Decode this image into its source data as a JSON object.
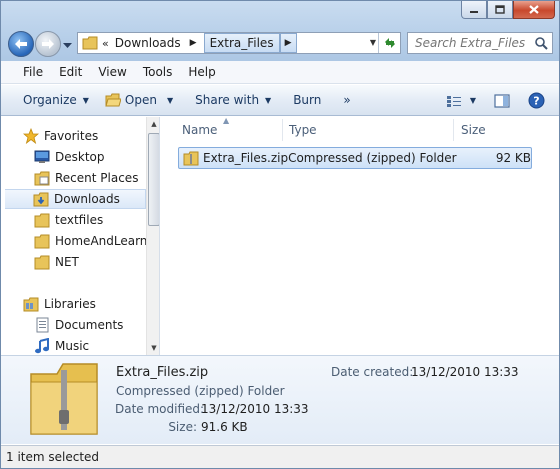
{
  "window": {
    "controls": {
      "minimize": "minimize",
      "maximize": "maximize",
      "close": "close"
    }
  },
  "address": {
    "overflow": "«",
    "crumbs": [
      {
        "label": "Downloads"
      },
      {
        "label": "Extra_Files"
      }
    ]
  },
  "search": {
    "placeholder": "Search Extra_Files"
  },
  "menu": [
    "File",
    "Edit",
    "View",
    "Tools",
    "Help"
  ],
  "toolbar": {
    "organize": "Organize",
    "open": "Open",
    "share_with": "Share with",
    "burn": "Burn",
    "more": "»"
  },
  "nav": {
    "favorites_header": "Favorites",
    "favorites": [
      {
        "label": "Desktop",
        "icon": "desktop-icon"
      },
      {
        "label": "Recent Places",
        "icon": "recent-places-icon"
      },
      {
        "label": "Downloads",
        "icon": "downloads-folder-icon",
        "selected": true
      },
      {
        "label": "textfiles",
        "icon": "folder-icon"
      },
      {
        "label": "HomeAndLearn",
        "icon": "folder-icon"
      },
      {
        "label": "NET",
        "icon": "folder-icon"
      }
    ],
    "libraries_header": "Libraries",
    "libraries": [
      {
        "label": "Documents",
        "icon": "documents-icon"
      },
      {
        "label": "Music",
        "icon": "music-icon"
      }
    ]
  },
  "columns": {
    "name": "Name",
    "type": "Type",
    "size": "Size"
  },
  "files": [
    {
      "name": "Extra_Files.zip",
      "type": "Compressed (zipped) Folder",
      "size": "92 KB"
    }
  ],
  "details": {
    "filename": "Extra_Files.zip",
    "type": "Compressed (zipped) Folder",
    "date_modified_label": "Date modified:",
    "date_modified": "13/12/2010 13:33",
    "size_label": "Size:",
    "size": "91.6 KB",
    "date_created_label": "Date created:",
    "date_created": "13/12/2010 13:33"
  },
  "status": {
    "text": "1 item selected"
  },
  "colors": {
    "accent": "#2866b8",
    "selection": "#cde1f7",
    "folder": "#e8c45a"
  }
}
